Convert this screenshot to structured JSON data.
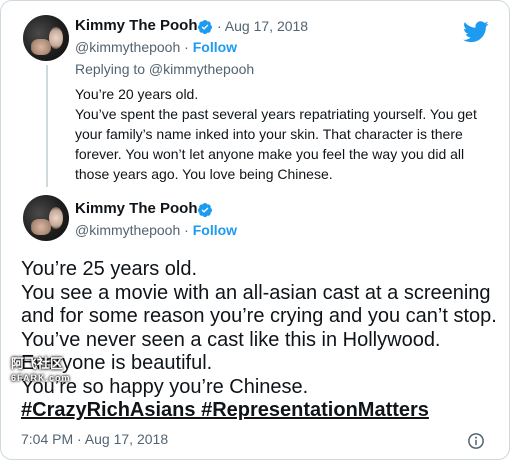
{
  "quoted_tweet": {
    "author_name": "Kimmy The Pooh",
    "date": "Aug 17, 2018",
    "handle": "@kimmythepooh",
    "separator": "·",
    "follow_label": "Follow",
    "replying_to": "Replying to @kimmythepooh",
    "text_lines": [
      "You’re 20 years old.",
      "You’ve spent the past several years repatriating yourself. You get your family’s name inked into your skin. That character is there forever. You won’t let anyone make you feel the way you did all those years ago. You love being Chinese."
    ]
  },
  "main_tweet": {
    "author_name": "Kimmy The Pooh",
    "handle": "@kimmythepooh",
    "separator": "·",
    "follow_label": "Follow",
    "text_lines": [
      "You’re 25 years old.",
      "You see a movie with an all-asian cast at a screening and for some reason you’re crying and you can’t stop. You’ve never seen a cast like this in Hollywood. Everyone is beautiful.",
      "You’re so happy you’re Chinese."
    ],
    "hashtags": "#CrazyRichAsians #RepresentationMatters",
    "timestamp": "7:04 PM · Aug 17, 2018"
  },
  "watermark": {
    "line1": "阿飞社区",
    "line2": "6FARK.com"
  },
  "icons": {
    "verified": "verified-badge-icon",
    "twitter": "twitter-bird-icon",
    "info": "info-icon"
  },
  "colors": {
    "accent": "#1d9bf0",
    "text": "#0f1419",
    "muted": "#536471",
    "border": "#cfd9de"
  }
}
